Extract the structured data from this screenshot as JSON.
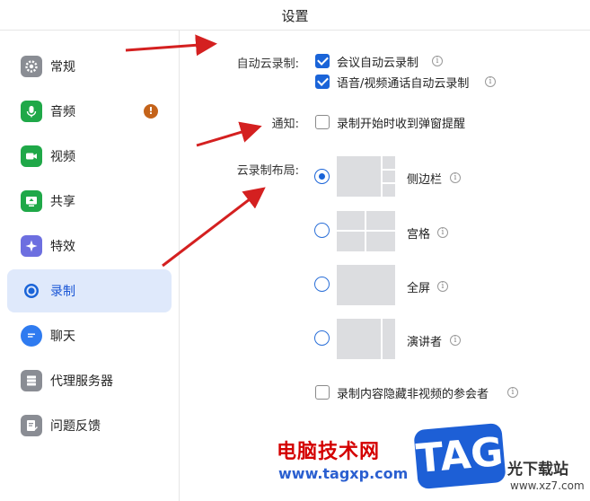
{
  "window": {
    "title": "设置"
  },
  "sidebar": {
    "items": [
      {
        "label": "常规",
        "icon": "gear-icon",
        "color": "#8a8d94",
        "active": false
      },
      {
        "label": "音频",
        "icon": "microphone-icon",
        "color": "#1fa848",
        "active": false,
        "badge": "!"
      },
      {
        "label": "视频",
        "icon": "video-camera-icon",
        "color": "#1fa848",
        "active": false
      },
      {
        "label": "共享",
        "icon": "screen-share-icon",
        "color": "#1fa848",
        "active": false
      },
      {
        "label": "特效",
        "icon": "sparkle-icon",
        "color": "#6d6fe0",
        "active": false
      },
      {
        "label": "录制",
        "icon": "record-icon",
        "color": "#1a64d8",
        "active": true
      },
      {
        "label": "聊天",
        "icon": "chat-bubble-icon",
        "color": "#2f7bf0",
        "active": false
      },
      {
        "label": "代理服务器",
        "icon": "server-icon",
        "color": "#8a8d94",
        "active": false
      },
      {
        "label": "问题反馈",
        "icon": "feedback-icon",
        "color": "#8a8d94",
        "active": false
      }
    ]
  },
  "recording": {
    "auto_cloud": {
      "label": "自动云录制:",
      "options": [
        {
          "label": "会议自动云录制",
          "checked": true
        },
        {
          "label": "语音/视频通话自动云录制",
          "checked": true
        }
      ]
    },
    "notify": {
      "label": "通知:",
      "option": {
        "label": "录制开始时收到弹窗提醒",
        "checked": false
      }
    },
    "layout": {
      "label": "云录制布局:",
      "options": [
        {
          "label": "侧边栏",
          "selected": true
        },
        {
          "label": "宫格",
          "selected": false
        },
        {
          "label": "全屏",
          "selected": false
        },
        {
          "label": "演讲者",
          "selected": false
        }
      ]
    },
    "hide_non_video": {
      "label": "录制内容隐藏非视频的参会者",
      "checked": false
    }
  },
  "watermark": {
    "cn_text": "电脑技术网",
    "url": "www.tagxp.com",
    "tag": "TAG",
    "xz_text": "光下载站",
    "xz_url": "www.xz7.com"
  },
  "colors": {
    "accent": "#1a64d8",
    "annotation_arrow": "#d42020",
    "active_bg": "#dfe9fb"
  }
}
